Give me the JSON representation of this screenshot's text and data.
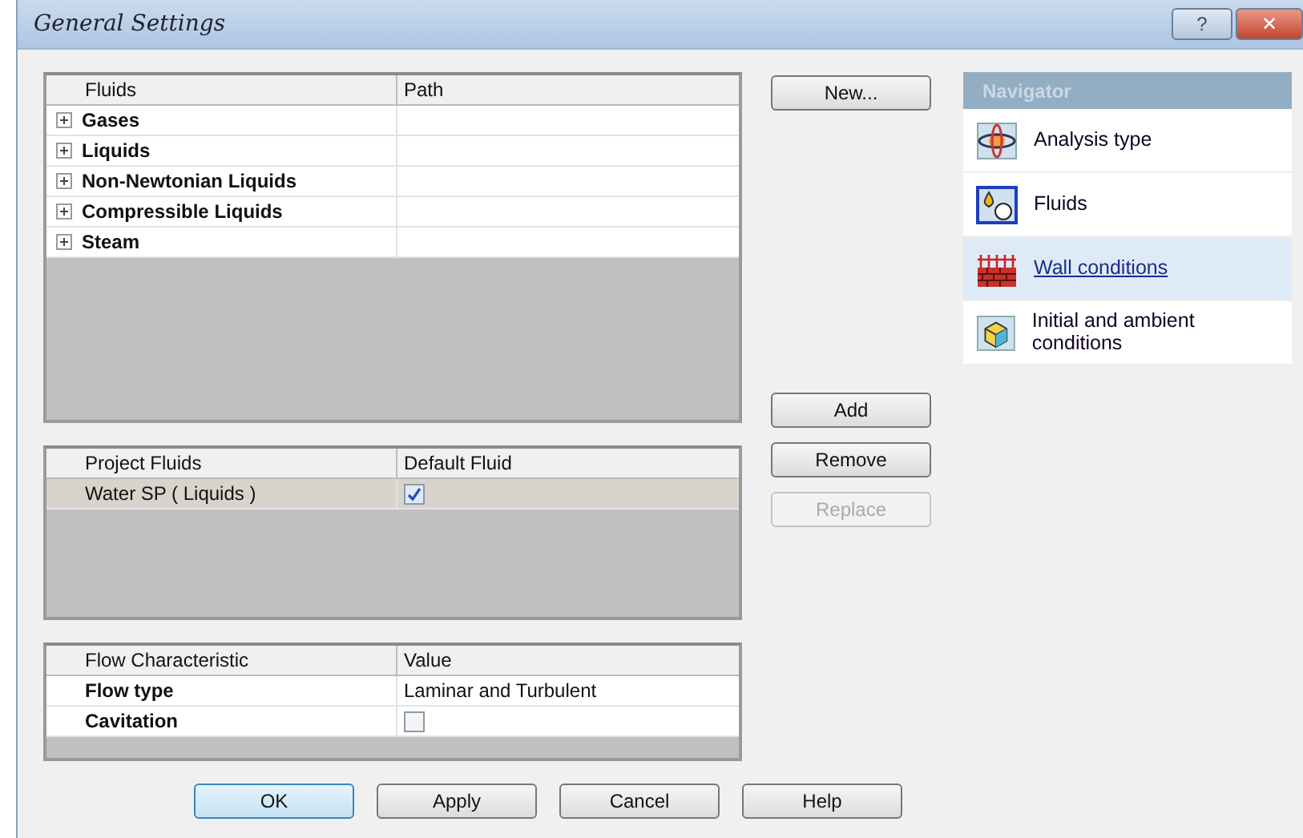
{
  "window": {
    "title": "General Settings",
    "controls": [
      "?",
      "✕"
    ]
  },
  "fluids_table": {
    "columns": [
      "Fluids",
      "Path"
    ],
    "rows": [
      {
        "name": "Gases",
        "expanded": false
      },
      {
        "name": "Liquids",
        "expanded": false
      },
      {
        "name": "Non-Newtonian Liquids",
        "expanded": false
      },
      {
        "name": "Compressible Liquids",
        "expanded": false
      },
      {
        "name": "Steam",
        "expanded": false
      }
    ]
  },
  "project_fluids_table": {
    "columns": [
      "Project Fluids",
      "Default Fluid"
    ],
    "rows": [
      {
        "name": "Water SP ( Liquids )",
        "selected": true,
        "checked": true
      }
    ]
  },
  "flow_table": {
    "columns": [
      "Flow Characteristic",
      "Value"
    ],
    "rows": [
      {
        "name": "Flow type",
        "kind": "text",
        "value": "Laminar and Turbulent"
      },
      {
        "name": "Cavitation",
        "kind": "checkbox",
        "checked": false
      }
    ]
  },
  "top_buttons": [
    {
      "label": "New...",
      "disabled": false
    }
  ],
  "list_buttons": [
    {
      "label": "Add",
      "disabled": false
    },
    {
      "label": "Remove",
      "disabled": false
    },
    {
      "label": "Replace",
      "disabled": true
    }
  ],
  "navigator": {
    "title": "Navigator",
    "items": [
      {
        "label": "Analysis type",
        "kind": "analysis",
        "selected": false
      },
      {
        "label": "Fluids",
        "kind": "fluids",
        "selected": false
      },
      {
        "label": "Wall conditions",
        "kind": "wall",
        "selected": true
      },
      {
        "label": "Initial and ambient conditions",
        "kind": "initial",
        "selected": false
      }
    ]
  },
  "buttons": [
    {
      "label": "OK",
      "default": true
    },
    {
      "label": "Apply",
      "default": false
    },
    {
      "label": "Cancel",
      "default": false
    },
    {
      "label": "Help",
      "default": false
    }
  ]
}
